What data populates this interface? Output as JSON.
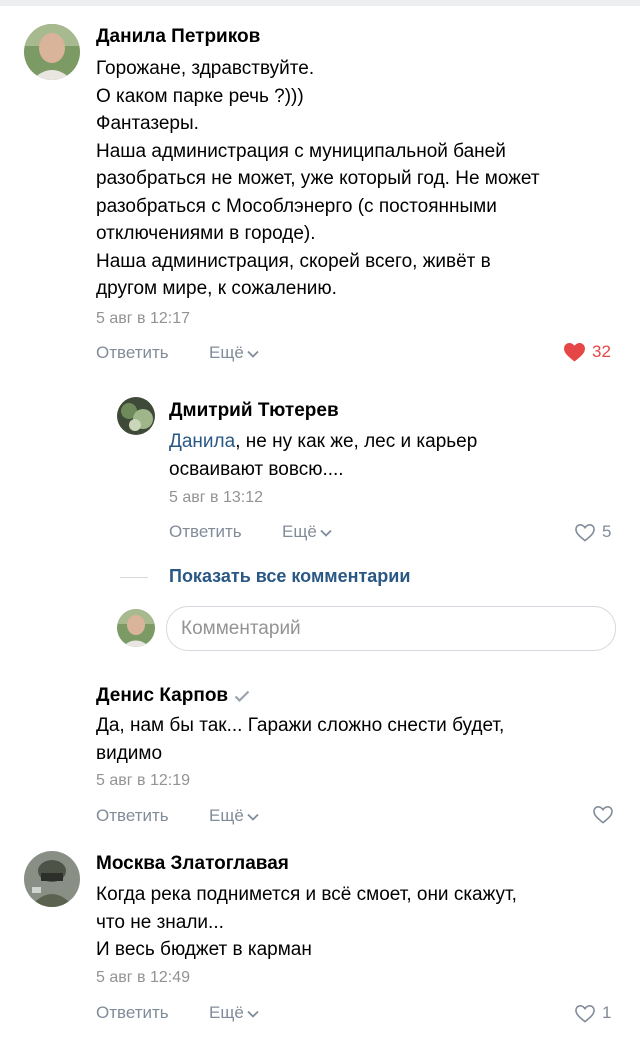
{
  "comments": [
    {
      "author": "Данила Петриков",
      "text": "Горожане, здравствуйте.\nО каком парке речь ?)))\nФантазеры.\nНаша администрация с муниципальной баней\nразобраться не может, уже который год. Не может\nразобраться с Мособлэнерго (с постоянными\nотключениями в городе).\nНаша администрация, скорей всего, живёт в\nдругом мире, к сожалению.",
      "date": "5 авг в 12:17",
      "reply_label": "Ответить",
      "more_label": "Ещё",
      "likes": "32",
      "liked": true
    },
    {
      "author": "Денис Карпов",
      "verified": true,
      "text": "Да, нам бы так... Гаражи сложно снести будет,\nвидимо",
      "date": "5 авг в 12:19",
      "reply_label": "Ответить",
      "more_label": "Ещё",
      "likes": "",
      "liked": false
    },
    {
      "author": "Москва Златоглавая",
      "text": "Когда река поднимется и всё смоет, они скажут,\nчто не знали...\nИ весь бюджет в карман",
      "date": "5 авг в 12:49",
      "reply_label": "Ответить",
      "more_label": "Ещё",
      "likes": "1",
      "liked": false
    }
  ],
  "reply": {
    "author": "Дмитрий Тютерев",
    "mention": "Данила",
    "text_line1_rest": ", не ну как же, лес и карьер",
    "text_line2": "осваивают вовсю....",
    "date": "5 авг в 13:12",
    "reply_label": "Ответить",
    "more_label": "Ещё",
    "likes": "5",
    "liked": false
  },
  "thread": {
    "show_all_label": "Показать все комментарии",
    "comment_placeholder": "Комментарий"
  },
  "colors": {
    "link": "#2a5885",
    "muted": "#818c99",
    "like_active": "#e64646"
  }
}
